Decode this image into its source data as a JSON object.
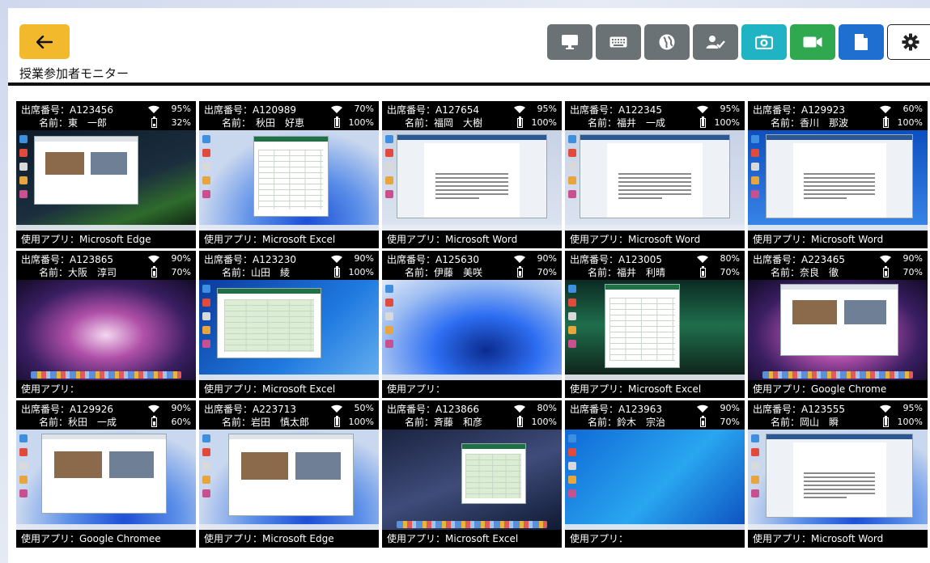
{
  "page": {
    "title": "授業参加者モニター"
  },
  "toolbar": {
    "buttons": [
      {
        "name": "monitor-icon",
        "color": "#6b7276"
      },
      {
        "name": "keyboard-icon",
        "color": "#6b7276"
      },
      {
        "name": "globe-icon",
        "color": "#6b7276"
      },
      {
        "name": "user-check-icon",
        "color": "#6b7276"
      },
      {
        "name": "camera-icon",
        "color": "#1fb3c4"
      },
      {
        "name": "video-camera-icon",
        "color": "#2fa84f"
      },
      {
        "name": "document-icon",
        "color": "#1f6fd0"
      },
      {
        "name": "gear-icon",
        "color": "#ffffff"
      }
    ],
    "back_color": "#f2b92d"
  },
  "students": [
    {
      "id": "出席番号：A123456",
      "name": "名前：東　一郎",
      "wifi": "95%",
      "battery": "32%",
      "app": "使用アプリ：Microsoft Edge",
      "screen": "edge-night"
    },
    {
      "id": "出席番号：A120989",
      "name": "名前：　秋田　好恵",
      "wifi": "70%",
      "battery": "100%",
      "app": "使用アプリ：Microsoft Excel",
      "screen": "excel-win11"
    },
    {
      "id": "出席番号：A127654",
      "name": "名前：福岡　大樹",
      "wifi": "95%",
      "battery": "100%",
      "app": "使用アプリ：Microsoft Word",
      "screen": "word"
    },
    {
      "id": "出席番号：A122345",
      "name": "名前：福井　一成",
      "wifi": "95%",
      "battery": "100%",
      "app": "使用アプリ：Microsoft Word",
      "screen": "word"
    },
    {
      "id": "出席番号：A129923",
      "name": "名前：香川　那波",
      "wifi": "60%",
      "battery": "100%",
      "app": "使用アプリ：Microsoft Word",
      "screen": "word-blue"
    },
    {
      "id": "出席番号：A123865",
      "name": "名前：大阪　淳司",
      "wifi": "90%",
      "battery": "70%",
      "app": "使用アプリ：",
      "screen": "mac-galaxy"
    },
    {
      "id": "出席番号：A123230",
      "name": "名前：山田　綾",
      "wifi": "90%",
      "battery": "100%",
      "app": "使用アプリ：Microsoft Excel",
      "screen": "excel-win10"
    },
    {
      "id": "出席番号：A125630",
      "name": "名前：伊藤　美咲",
      "wifi": "90%",
      "battery": "70%",
      "app": "使用アプリ：",
      "screen": "win11-bloom"
    },
    {
      "id": "出席番号：A123005",
      "name": "名前：福井　利晴",
      "wifi": "80%",
      "battery": "70%",
      "app": "使用アプリ：Microsoft Excel",
      "screen": "excel-aurora"
    },
    {
      "id": "出席番号：A223465",
      "name": "名前：奈良　徹",
      "wifi": "90%",
      "battery": "70%",
      "app": "使用アプリ：Google Chrome",
      "screen": "chrome-mac"
    },
    {
      "id": "出席番号：A129926",
      "name": "名前：秋田　一成",
      "wifi": "90%",
      "battery": "60%",
      "app": "使用アプリ：Google Chromee",
      "screen": "chrome-win11"
    },
    {
      "id": "出席番号：A223713",
      "name": "名前：岩田　慎太郎",
      "wifi": "50%",
      "battery": "100%",
      "app": "使用アプリ：Microsoft Edge",
      "screen": "edge-win11"
    },
    {
      "id": "出席番号：A123866",
      "name": "名前：斉藤　和彦",
      "wifi": "80%",
      "battery": "100%",
      "app": "使用アプリ：Microsoft Excel",
      "screen": "excel-mac"
    },
    {
      "id": "出席番号：A123963",
      "name": "名前：鈴木　宗治",
      "wifi": "90%",
      "battery": "70%",
      "app": "使用アプリ：",
      "screen": "win10-blue"
    },
    {
      "id": "出席番号：A123555",
      "name": "名前：岡山　瞬",
      "wifi": "95%",
      "battery": "100%",
      "app": "使用アプリ：Microsoft Word",
      "screen": "word-win11"
    }
  ]
}
